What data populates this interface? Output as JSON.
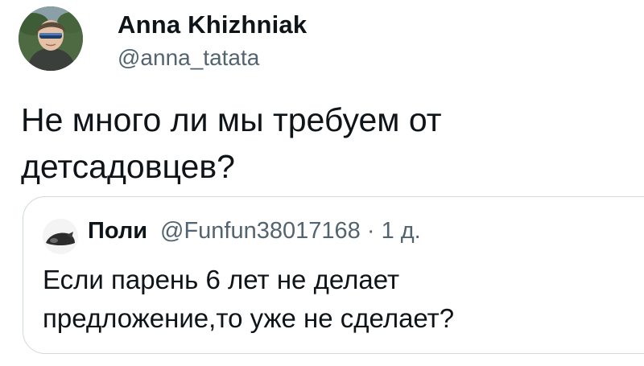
{
  "tweet": {
    "author": {
      "name": "Anna Khizhniak",
      "handle": "@anna_tatata",
      "avatar_icon": "user-avatar"
    },
    "text_lines": [
      "Не много ли мы требуем от",
      "детсадовцев?"
    ]
  },
  "quoted_tweet": {
    "author": {
      "name": "Поли",
      "handle": "@Funfun38017168",
      "avatar_icon": "user-avatar"
    },
    "separator": "·",
    "time": "1 д.",
    "text_lines": [
      "Если парень 6 лет не делает",
      "предложение,то уже не сделает?"
    ]
  },
  "colors": {
    "text": "#0f1419",
    "secondary": "#536471",
    "border": "#cfd9de"
  }
}
